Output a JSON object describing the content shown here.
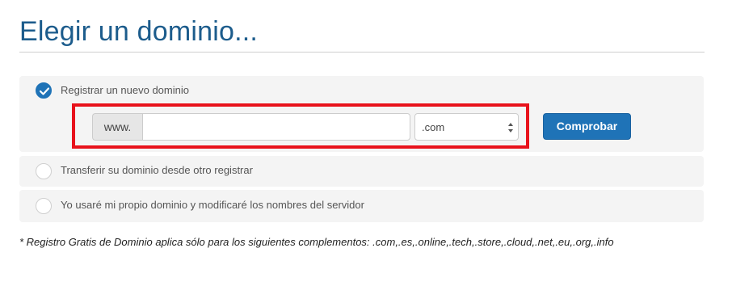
{
  "page": {
    "title": "Elegir un dominio..."
  },
  "options": [
    {
      "label": "Registrar un nuevo dominio",
      "selected": true
    },
    {
      "label": "Transferir su dominio desde otro registrar",
      "selected": false
    },
    {
      "label": "Yo usaré mi propio dominio y modificaré los nombres del servidor",
      "selected": false
    }
  ],
  "register": {
    "prefix": "www.",
    "domain_value": "",
    "tld_selected": ".com",
    "check_button": "Comprobar"
  },
  "footnote": "* Registro Gratis de Dominio aplica sólo para los siguientes complementos: .com,.es,.online,.tech,.store,.cloud,.net,.eu,.org,.info",
  "colors": {
    "title": "#1c5c8c",
    "primary_button": "#1f73b7",
    "highlight_border": "#e8121b"
  }
}
